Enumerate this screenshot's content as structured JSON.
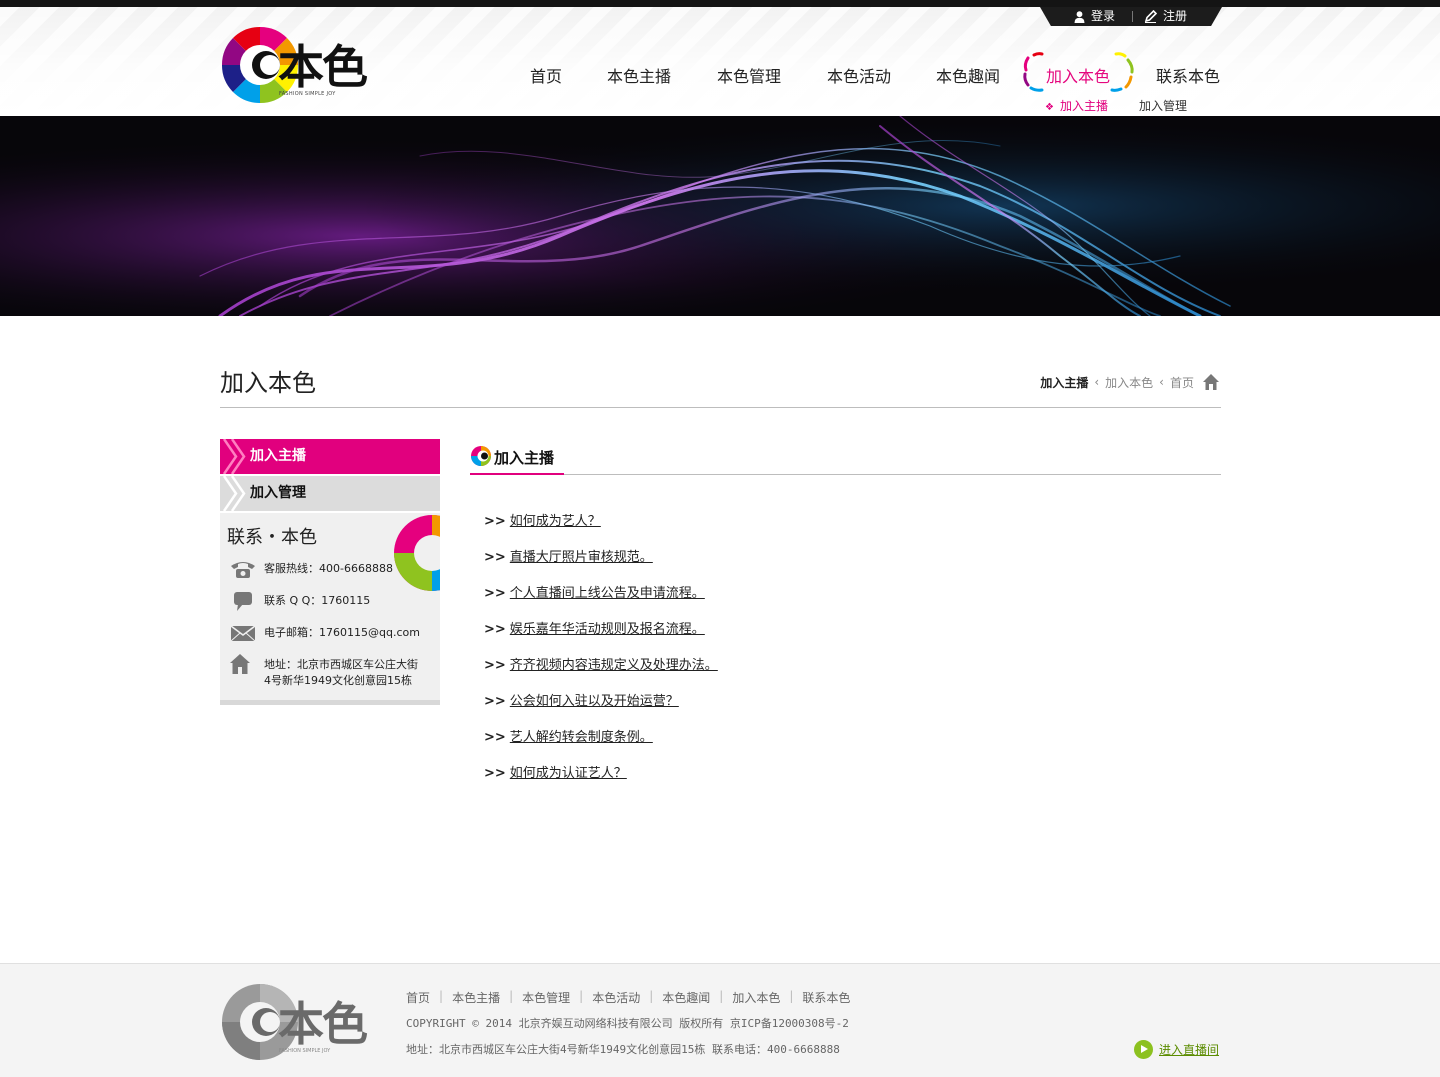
{
  "userbar": {
    "login": "登录",
    "register": "注册"
  },
  "logo": {
    "text": "本色",
    "sub": "FASHION SIMPLE JOY"
  },
  "nav": {
    "items": [
      "首页",
      "本色主播",
      "本色管理",
      "本色活动",
      "本色趣闻",
      "加入本色",
      "联系本色"
    ],
    "active_index": 5
  },
  "subnav": {
    "items": [
      "加入主播",
      "加入管理"
    ],
    "active_index": 0
  },
  "page": {
    "title": "加入本色",
    "breadcrumb": {
      "current": "加入主播",
      "parent": "加入本色",
      "home": "首页"
    }
  },
  "sidebar": {
    "items": [
      "加入主播",
      "加入管理"
    ],
    "contact_title": "联系・本色",
    "hotline": "客服热线：400-6668888",
    "qq": "联系 Q Q：1760115",
    "email": "电子邮箱：1760115@qq.com",
    "address_1": "地址：北京市西城区车公庄大街",
    "address_2": "4号新华1949文化创意园15栋"
  },
  "content": {
    "title": "加入主播",
    "arrow": ">>",
    "links": [
      "如何成为艺人？",
      "直播大厅照片审核规范。",
      "个人直播间上线公告及申请流程。",
      "娱乐嘉年华活动规则及报名流程。",
      "齐齐视频内容违规定义及处理办法。",
      "公会如何入驻以及开始运营？",
      "艺人解约转会制度条例。",
      "如何成为认证艺人？"
    ]
  },
  "footer": {
    "nav": [
      "首页",
      "本色主播",
      "本色管理",
      "本色活动",
      "本色趣闻",
      "加入本色",
      "联系本色"
    ],
    "separator": "|",
    "copyright": "COPYRIGHT © 2014 北京齐娱互动网络科技有限公司 版权所有  京ICP备12000308号-2",
    "address": "地址：北京市西城区车公庄大街4号新华1949文化创意园15栋  联系电话：400-6668888",
    "enter_live": "进入直播间"
  },
  "colors": {
    "accent": "#e1007e",
    "green": "#8cc11f"
  }
}
